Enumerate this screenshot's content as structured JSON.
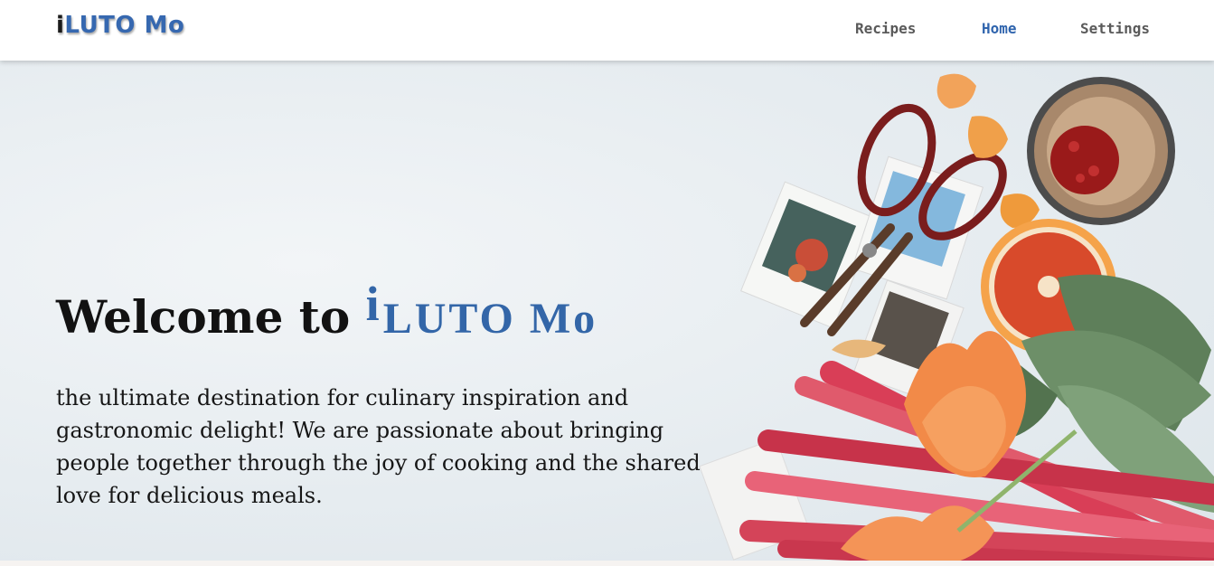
{
  "header": {
    "logo_prefix": "i",
    "logo_rest": "LUTO Mo",
    "nav": {
      "recipes": "Recipes",
      "home": "Home",
      "settings": "Settings"
    },
    "active_nav": "Home"
  },
  "hero": {
    "title_prefix": "Welcome to",
    "brand_i": "i",
    "brand_rest": "LUTO Mo",
    "description": "the ultimate destination for culinary inspiration and gastronomic delight! We are passionate about bringing people together through the joy of cooking and the shared love for delicious meals."
  },
  "colors": {
    "brand_blue": "#3366a8",
    "nav_active": "#2f64ad",
    "nav_default": "#5a5a5a",
    "text_dark": "#121212"
  }
}
